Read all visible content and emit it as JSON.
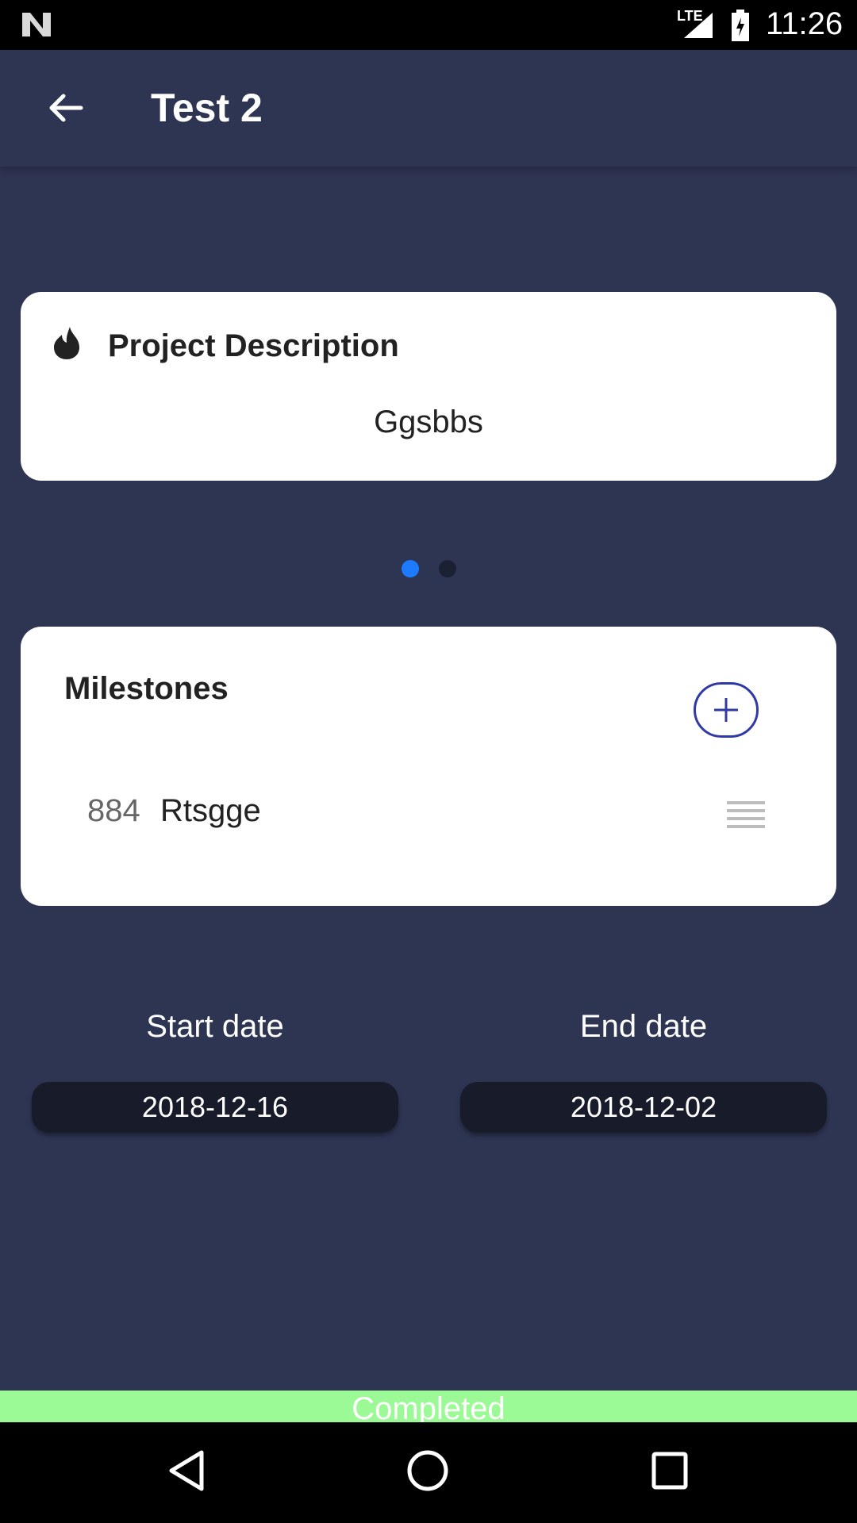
{
  "status_bar": {
    "network": "LTE",
    "time": "11:26"
  },
  "app_bar": {
    "title": "Test 2"
  },
  "description_card": {
    "title": "Project Description",
    "text": "Ggsbbs"
  },
  "pager": {
    "active_index": 0,
    "count": 2
  },
  "milestones_card": {
    "title": "Milestones",
    "items": [
      {
        "number": "884",
        "name": "Rtsgge"
      }
    ]
  },
  "dates": {
    "start_label": "Start date",
    "start_value": "2018-12-16",
    "end_label": "End date",
    "end_value": "2018-12-02"
  },
  "status": {
    "label": "Completed",
    "color": "#9cfa96"
  },
  "colors": {
    "background": "#2e3553",
    "accent": "#1e7bff",
    "add_button": "#2f3aa6"
  }
}
